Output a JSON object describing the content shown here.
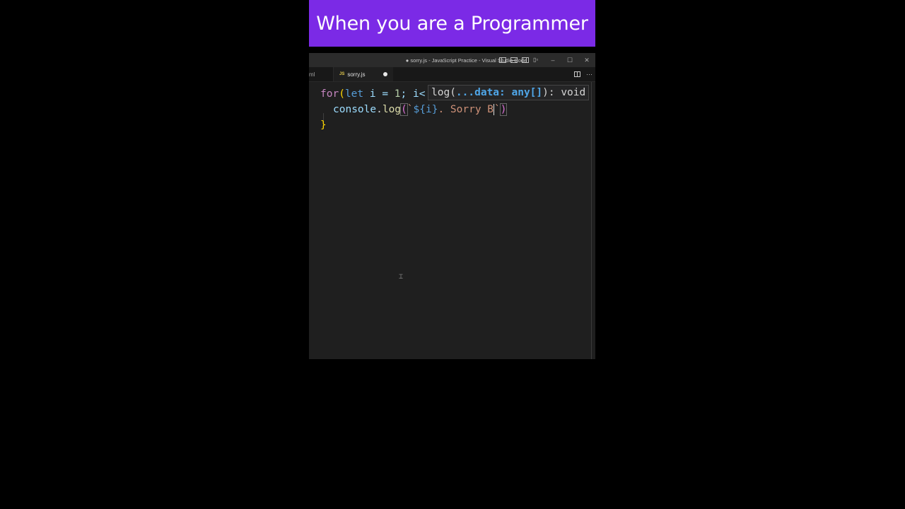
{
  "banner": {
    "title": "When you are a Programmer",
    "color": "#7b2ae6"
  },
  "window": {
    "title": "● sorry.js - JavaScript Practice - Visual Studio Code",
    "controls": {
      "minimize": "–",
      "maximize": "☐",
      "close": "✕"
    }
  },
  "tabs": [
    {
      "label": "ml",
      "active": false
    },
    {
      "label": "sorry.js",
      "badge": "JS",
      "active": true,
      "modified": true
    }
  ],
  "tab_actions": {
    "more": "···"
  },
  "code": {
    "line1": {
      "kw": "for",
      "open": "(",
      "let": "let",
      "rest": " i = ",
      "num": "1",
      "rest2": "; i<"
    },
    "line2": {
      "obj": "console",
      "dot": ".",
      "fn": "log",
      "open": "(",
      "tick": "`",
      "tmpl": "${i}",
      "text": ". Sorry B",
      "tick2": "`",
      "close": ")"
    },
    "line3": {
      "brace": "}"
    }
  },
  "hover": {
    "prefix": "log(",
    "param": "...data: any[]",
    "suffix": "): void"
  }
}
